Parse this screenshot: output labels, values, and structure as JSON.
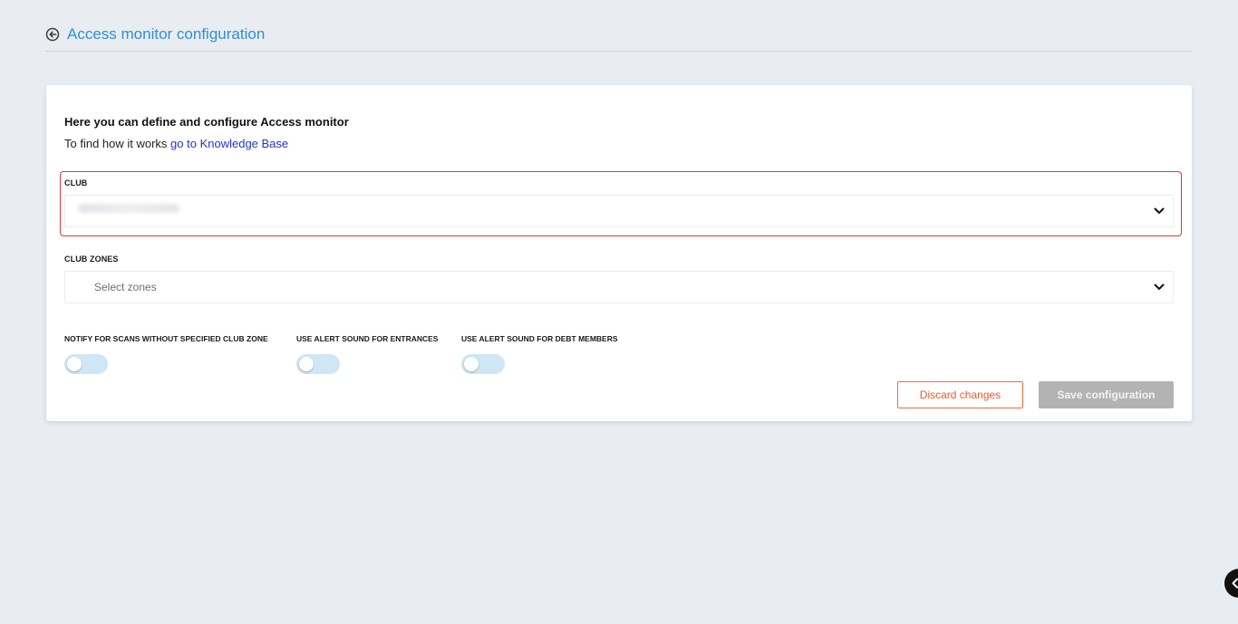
{
  "header": {
    "title": "Access monitor configuration",
    "back_icon": "arrow-left-circle-icon"
  },
  "intro": {
    "title": "Here you can define and configure Access monitor",
    "text": "To find how it works ",
    "link_text": "go to Knowledge Base"
  },
  "club": {
    "label": "CLUB",
    "value": "",
    "chevron_icon": "chevron-down-icon"
  },
  "club_zones": {
    "label": "CLUB ZONES",
    "placeholder": "Select zones",
    "chevron_icon": "chevron-down-icon"
  },
  "toggles": [
    {
      "label": "NOTIFY FOR SCANS WITHOUT SPECIFIED CLUB ZONE",
      "on": false
    },
    {
      "label": "USE ALERT SOUND FOR ENTRANCES",
      "on": false
    },
    {
      "label": "USE ALERT SOUND FOR DEBT MEMBERS",
      "on": false
    }
  ],
  "buttons": {
    "discard": "Discard changes",
    "save": "Save configuration"
  },
  "colors": {
    "accent": "#2f8fd6",
    "link": "#2035c9",
    "highlight_border": "#e0393e",
    "discard": "#f0582a",
    "save_disabled": "#b3b3b3",
    "toggle_track": "#cfe6f5"
  },
  "floating_button_icon": "chevron-left-icon"
}
